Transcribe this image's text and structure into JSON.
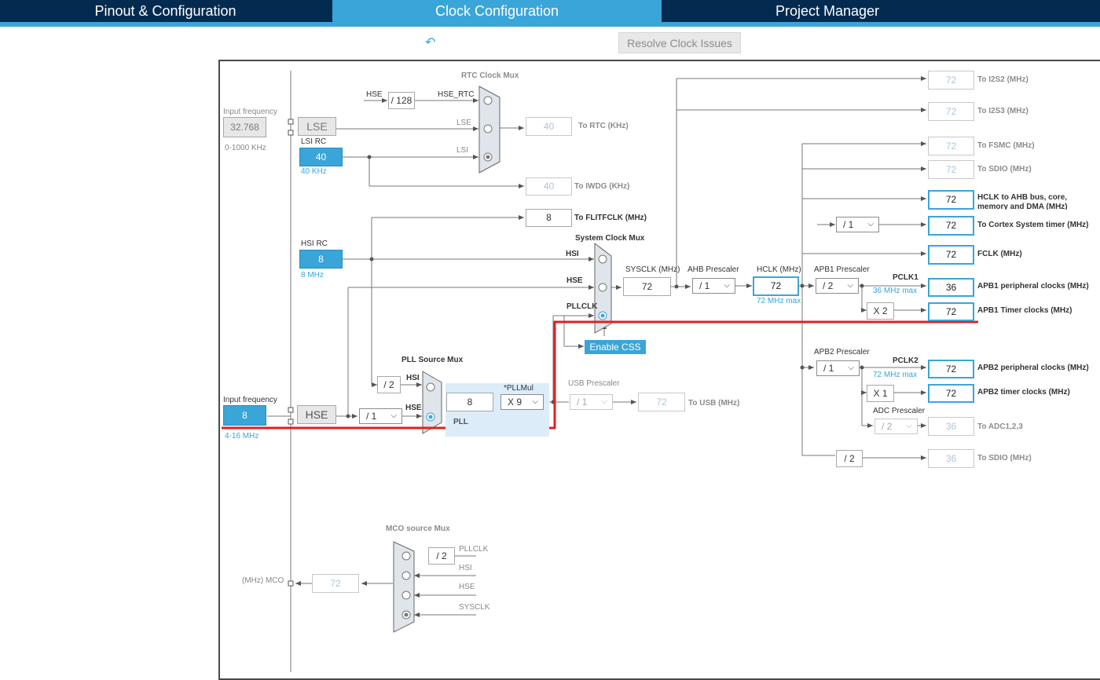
{
  "tabs": {
    "pinout": "Pinout & Configuration",
    "clock": "Clock Configuration",
    "project": "Project Manager"
  },
  "toolbar": {
    "undo_icon": "undo-icon",
    "resolve_label": "Resolve Clock Issues"
  },
  "colors": {
    "accent": "#3aa5d8",
    "header_bg": "#032b50",
    "highlight_red": "#e02020"
  },
  "lse": {
    "input_label": "Input frequency",
    "input_value": "32.768",
    "range": "0-1000 KHz",
    "button": "LSE"
  },
  "lsi": {
    "title": "LSI RC",
    "value": "40",
    "unit": "40 KHz"
  },
  "rtc": {
    "title": "RTC Clock Mux",
    "hse_label": "HSE",
    "div": "/ 128",
    "hse_rtc": "HSE_RTC",
    "lse_label": "LSE",
    "lsi_label": "LSI",
    "out_value": "40",
    "out_label": "To RTC (KHz)"
  },
  "iwdg": {
    "value": "40",
    "label": "To IWDG (KHz)"
  },
  "flit": {
    "value": "8",
    "label": "To FLITFCLK (MHz)"
  },
  "hsi": {
    "title": "HSI RC",
    "value": "8",
    "unit": "8 MHz"
  },
  "sysmux": {
    "title": "System Clock Mux",
    "hsi": "HSI",
    "hse": "HSE",
    "pllclk": "PLLCLK",
    "sysclk_label": "SYSCLK (MHz)",
    "sysclk_value": "72"
  },
  "ahb": {
    "label": "AHB Prescaler",
    "value": "/ 1"
  },
  "hclk": {
    "label": "HCLK (MHz)",
    "value": "72",
    "max": "72 MHz max"
  },
  "apb1": {
    "label": "APB1 Prescaler",
    "value": "/ 2",
    "pclk": "PCLK1",
    "max": "36 MHz max",
    "periph_value": "36",
    "periph_label": "APB1 peripheral clocks (MHz)",
    "mult": "X 2",
    "timer_value": "72",
    "timer_label": "APB1 Timer clocks (MHz)"
  },
  "enable_css": "Enable CSS",
  "outputs": {
    "i2s2_value": "72",
    "i2s2_label": "To I2S2 (MHz)",
    "i2s3_value": "72",
    "i2s3_label": "To I2S3 (MHz)",
    "fsmc_value": "72",
    "fsmc_label": "To FSMC (MHz)",
    "sdio_value": "72",
    "sdio_label": "To SDIO (MHz)",
    "hclk_ahb_value": "72",
    "hclk_ahb_label": "HCLK to AHB bus, core,",
    "hclk_ahb_label2": "memory and DMA (MHz)",
    "cortex_div": "/ 1",
    "cortex_value": "72",
    "cortex_label": "To Cortex System timer (MHz)",
    "fclk_value": "72",
    "fclk_label": "FCLK (MHz)"
  },
  "apb2": {
    "label": "APB2 Prescaler",
    "value": "/ 1",
    "pclk": "PCLK2",
    "max": "72 MHz max",
    "periph_value": "72",
    "periph_label": "APB2 peripheral clocks (MHz)",
    "mult": "X 1",
    "timer_value": "72",
    "timer_label": "APB2 timer clocks (MHz)",
    "adc_label": "ADC Prescaler",
    "adc_value": "/ 2",
    "adc_out": "36",
    "adc_out_label": "To ADC1,2,3",
    "sdio_div": "/ 2",
    "sdio_value": "36",
    "sdio_label": "To SDIO (MHz)"
  },
  "pll": {
    "mux_title": "PLL Source Mux",
    "div2": "/ 2",
    "hsi": "HSI",
    "hse": "HSE",
    "value": "8",
    "mul_label": "*PLLMul",
    "mul": "X 9",
    "name": "PLL"
  },
  "usb": {
    "label": "USB Prescaler",
    "value": "/ 1",
    "out": "72",
    "out_label": "To USB (MHz)"
  },
  "hse": {
    "input_label": "Input frequency",
    "input_value": "8",
    "range": "4-16 MHz",
    "button": "HSE",
    "div": "/ 1"
  },
  "mco": {
    "title": "MCO source Mux",
    "div": "/ 2",
    "pllclk": "PLLCLK",
    "hsi": "HSI",
    "hse": "HSE",
    "sysclk": "SYSCLK",
    "value": "72",
    "label": "(MHz) MCO"
  }
}
